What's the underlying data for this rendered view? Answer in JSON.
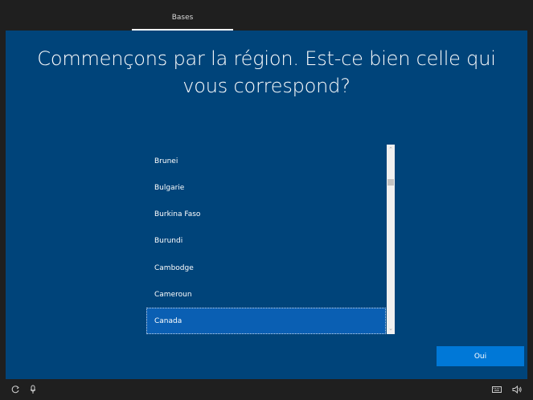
{
  "topbar": {
    "tab_label": "Bases"
  },
  "main": {
    "heading_line1": "Commençons par la région. Est-ce bien celle qui",
    "heading_line2": "vous correspond?"
  },
  "region_list": {
    "items": [
      {
        "label": "Brunei",
        "selected": false
      },
      {
        "label": "Bulgarie",
        "selected": false
      },
      {
        "label": "Burkina Faso",
        "selected": false
      },
      {
        "label": "Burundi",
        "selected": false
      },
      {
        "label": "Cambodge",
        "selected": false
      },
      {
        "label": "Cameroun",
        "selected": false
      },
      {
        "label": "Canada",
        "selected": true
      }
    ]
  },
  "actions": {
    "confirm_label": "Oui"
  },
  "bottombar": {
    "left_icons": [
      "accessibility-icon",
      "microphone-icon"
    ],
    "right_icons": [
      "keyboard-icon",
      "volume-icon"
    ]
  },
  "colors": {
    "background_blue": "#00447a",
    "selected_item": "#0a5fb3",
    "accent_button": "#0078d7",
    "chrome_dark": "#1f1f1f"
  }
}
